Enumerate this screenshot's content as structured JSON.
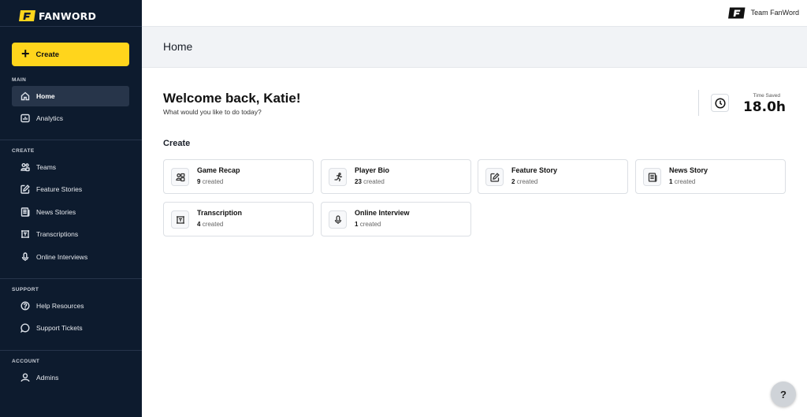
{
  "brand": {
    "name": "FANWORD"
  },
  "sidebar": {
    "create_label": "Create",
    "sections": {
      "main": "MAIN",
      "create": "CREATE",
      "support": "SUPPORT",
      "account": "ACCOUNT"
    },
    "items": {
      "home": "Home",
      "analytics": "Analytics",
      "teams": "Teams",
      "feature_stories": "Feature Stories",
      "news_stories": "News Stories",
      "transcriptions": "Transcriptions",
      "online_interviews": "Online Interviews",
      "help_resources": "Help Resources",
      "support_tickets": "Support Tickets",
      "admins": "Admins"
    }
  },
  "topbar": {
    "team_name": "Team FanWord"
  },
  "page": {
    "title": "Home"
  },
  "welcome": {
    "heading": "Welcome back, Katie!",
    "subtitle": "What would you like to do today?"
  },
  "time_saved": {
    "label": "Time Saved",
    "value": "18.0h"
  },
  "create_section": {
    "title": "Create",
    "created_suffix": "created",
    "cards": [
      {
        "title": "Game Recap",
        "count": "9",
        "icon": "game-recap-icon"
      },
      {
        "title": "Player Bio",
        "count": "23",
        "icon": "runner-icon"
      },
      {
        "title": "Feature Story",
        "count": "2",
        "icon": "pencil-square-icon"
      },
      {
        "title": "News Story",
        "count": "1",
        "icon": "newspaper-icon"
      },
      {
        "title": "Transcription",
        "count": "4",
        "icon": "transcription-icon"
      },
      {
        "title": "Online Interview",
        "count": "1",
        "icon": "microphone-icon"
      }
    ]
  },
  "help_button": {
    "label": "?"
  },
  "colors": {
    "sidebar_bg": "#0d1b2e",
    "accent": "#ffd51c",
    "active_item_bg": "#27354a",
    "header_bg": "#f1f3f6"
  }
}
